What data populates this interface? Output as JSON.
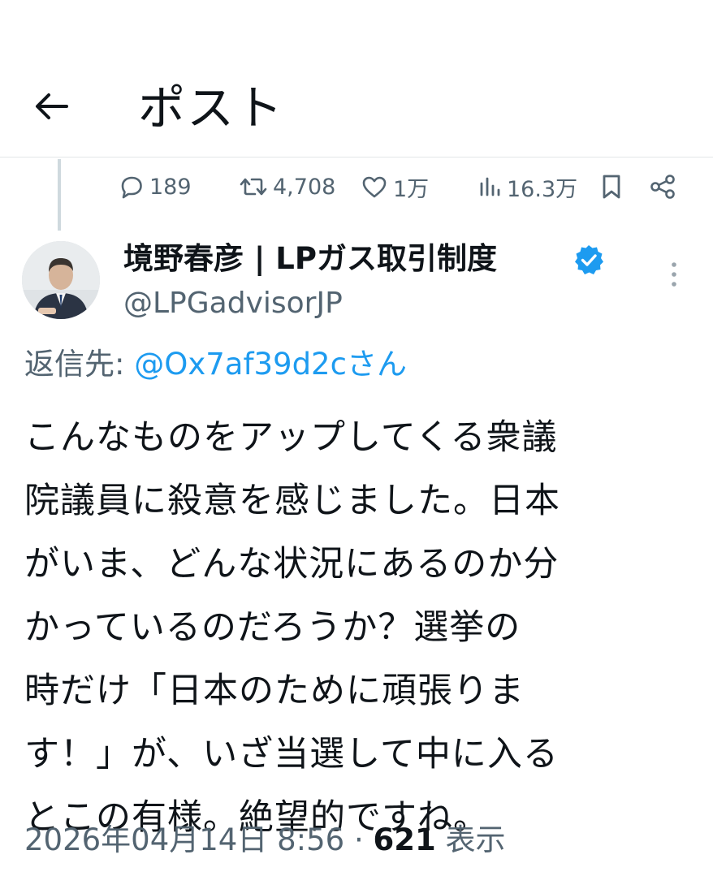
{
  "header": {
    "title": "ポスト"
  },
  "actions": {
    "replies": "189",
    "retweets": "4,708",
    "likes": "1万",
    "views": "16.3万"
  },
  "author": {
    "name": "境野春彦 | LPガス取引制度",
    "handle": "@LPGadvisorJP",
    "verified": true
  },
  "reply_to": {
    "prefix": "返信先: ",
    "mention": "@Ox7af39d2cさん"
  },
  "post": {
    "lines": [
      "こんなものをアップしてくる衆議",
      "院議員に殺意を感じました。日本",
      "がいま、どんな状況にあるのか分",
      "かっているのだろうか？選挙の",
      "時だけ「日本のために頑張りま",
      "す！」が、いざ当選して中に入る",
      "とこの有様。絶望的ですね。"
    ]
  },
  "meta": {
    "timestamp": "2026年04月14日 8:56",
    "separator": " · ",
    "views_count": "621",
    "views_label": " 表示"
  },
  "colors": {
    "text": "#0f1419",
    "secondary": "#536471",
    "accent": "#1d9bf0",
    "divider": "#e3e6e8"
  }
}
